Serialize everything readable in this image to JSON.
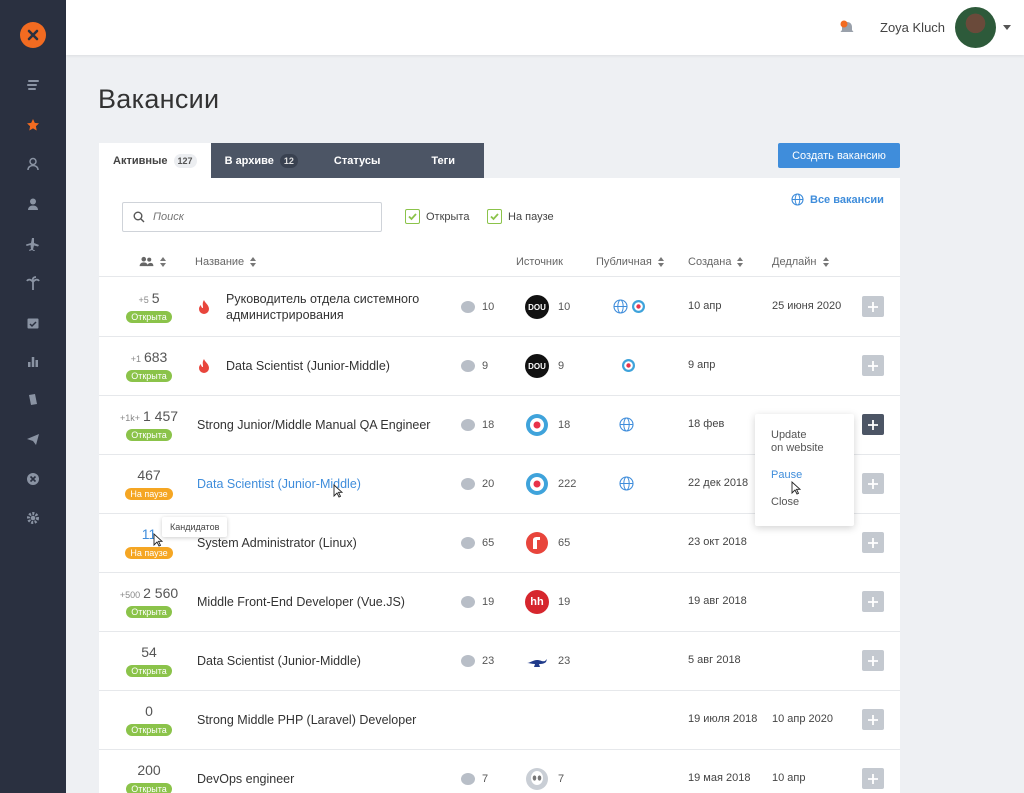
{
  "user": {
    "name": "Zoya Kluch"
  },
  "page": {
    "title": "Вакансии"
  },
  "tabs": [
    {
      "label": "Активные",
      "count": "127"
    },
    {
      "label": "В архиве",
      "count": "12"
    },
    {
      "label": "Статусы"
    },
    {
      "label": "Теги"
    }
  ],
  "create_button": "Создать вакансию",
  "search": {
    "placeholder": "Поиск"
  },
  "filters": [
    {
      "label": "Открыта",
      "checked": true
    },
    {
      "label": "На паузе",
      "checked": true
    }
  ],
  "all_vacancies_link": "Все вакансии",
  "columns": {
    "name": "Название",
    "source": "Источник",
    "public": "Публичная",
    "created": "Создана",
    "deadline": "Дедлайн"
  },
  "rows": [
    {
      "delta": "+5",
      "count": "5",
      "status": "Открыта",
      "title": "Руководитель отдела системного администрирования",
      "comments": "10",
      "source": "DOU",
      "source_count": "10",
      "created": "10 апр",
      "deadline": "25 июня 2020"
    },
    {
      "delta": "+1",
      "count": "683",
      "status": "Открыта",
      "title": "Data Scientist (Junior-Middle)",
      "comments": "9",
      "source": "DOU",
      "source_count": "9",
      "created": "9 апр",
      "deadline": ""
    },
    {
      "delta": "+1k+",
      "count": "1 457",
      "status": "Открыта",
      "title": "Strong Junior/Middle Manual QA Engineer",
      "comments": "18",
      "source": "target",
      "source_count": "18",
      "created": "18 фев",
      "deadline": ""
    },
    {
      "delta": "",
      "count": "467",
      "status": "На паузе",
      "title": "Data Scientist (Junior-Middle)",
      "comments": "20",
      "source": "target",
      "source_count": "222",
      "created": "22 дек 2018",
      "deadline": ""
    },
    {
      "delta": "",
      "count": "11",
      "status": "На паузе",
      "title": "System Administrator (Linux)",
      "comments": "65",
      "source": "r",
      "source_count": "65",
      "created": "23 окт 2018",
      "deadline": ""
    },
    {
      "delta": "+500",
      "count": "2 560",
      "status": "Открыта",
      "title": "Middle Front-End Developer (Vue.JS)",
      "comments": "19",
      "source": "hh",
      "source_count": "19",
      "created": "19 авг 2018",
      "deadline": ""
    },
    {
      "delta": "",
      "count": "54",
      "status": "Открыта",
      "title": "Data Scientist (Junior-Middle)",
      "comments": "23",
      "source": "lamp",
      "source_count": "23",
      "created": "5 авг 2018",
      "deadline": ""
    },
    {
      "delta": "",
      "count": "0",
      "status": "Открыта",
      "title": "Strong Middle PHP (Laravel) Developer",
      "comments": "",
      "source": "",
      "source_count": "",
      "created": "19 июля 2018",
      "deadline": "10 апр 2020"
    },
    {
      "delta": "",
      "count": "200",
      "status": "Открыта",
      "title": "DevOps engineer",
      "comments": "7",
      "source": "alien",
      "source_count": "7",
      "created": "19 мая 2018",
      "deadline": "10 апр"
    }
  ],
  "context_menu": {
    "update_line1": "Update",
    "update_line2": "on website",
    "pause": "Pause",
    "close": "Close"
  },
  "tooltip": "Кандидатов",
  "colors": {
    "accent": "#3f8ddb",
    "open": "#8bc34a",
    "paused": "#f5a623",
    "sidebar": "#2a3040",
    "brand": "#f26b21"
  }
}
